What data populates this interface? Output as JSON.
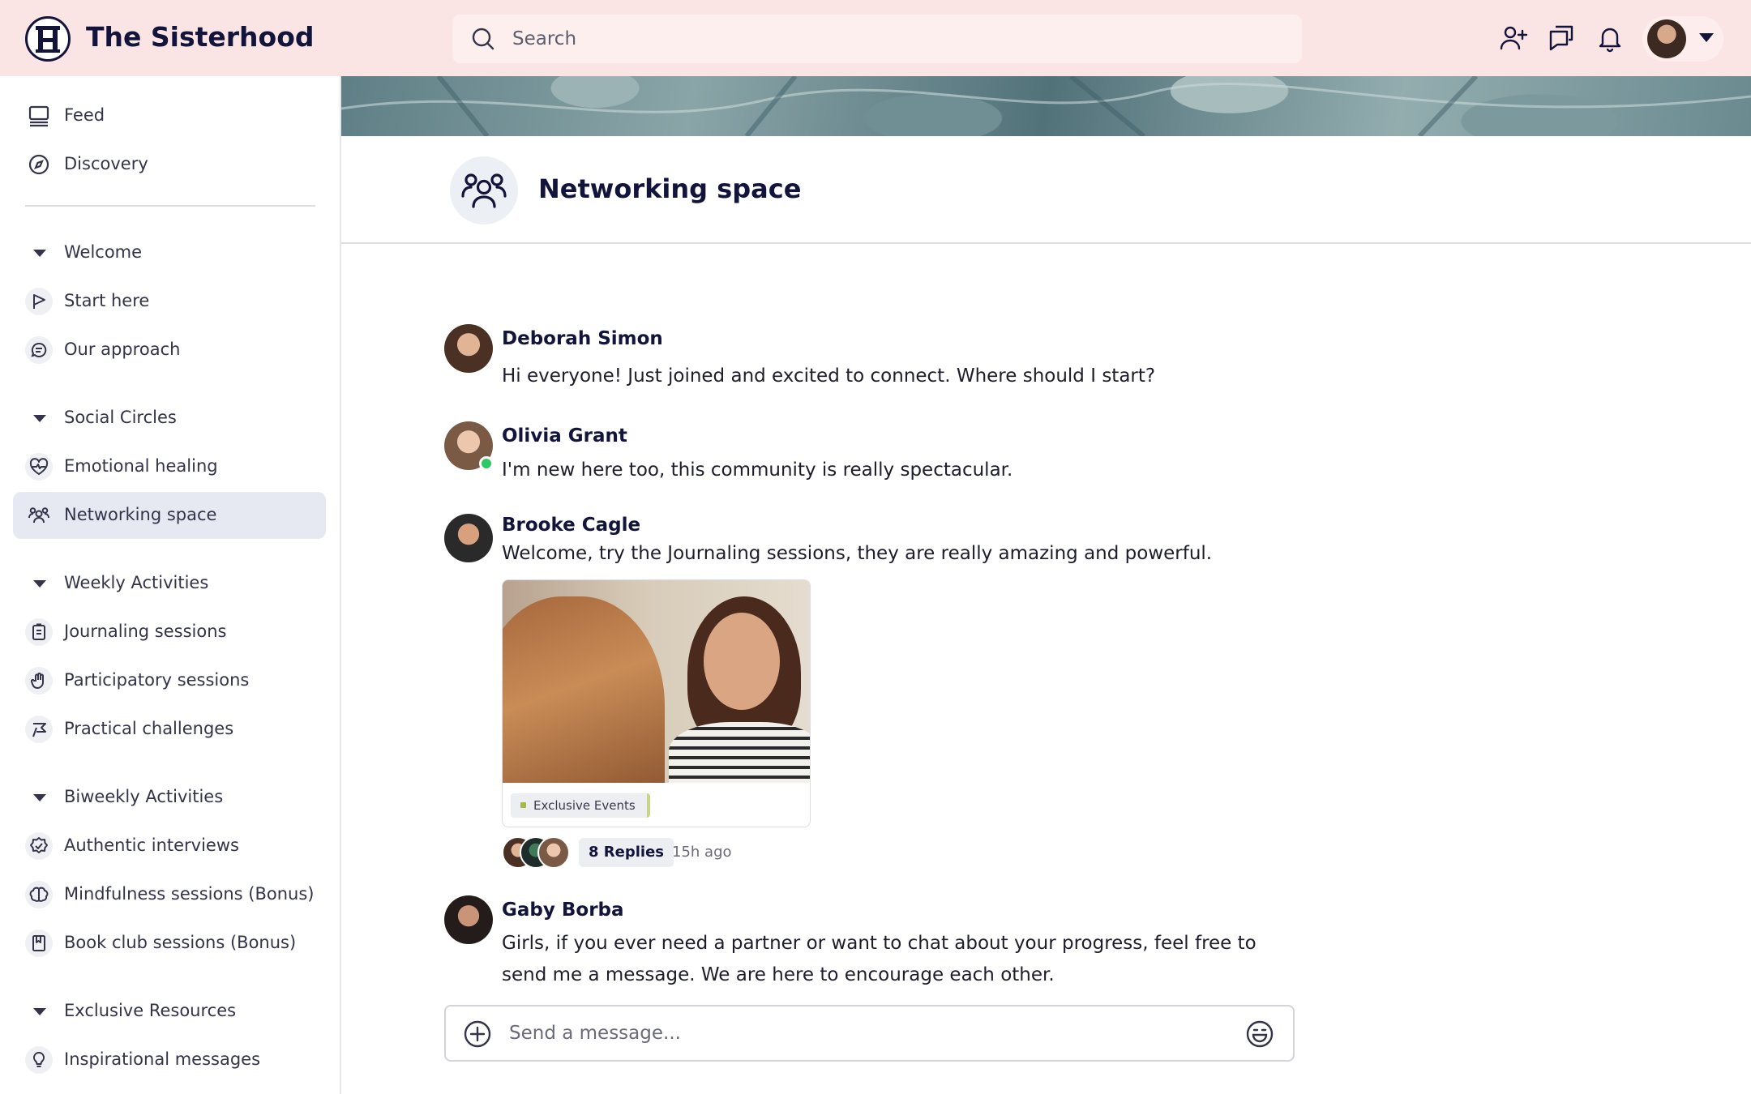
{
  "app": {
    "brand": "The Sisterhood"
  },
  "search": {
    "placeholder": "Search"
  },
  "topbar": {
    "icons": [
      "add-friend-icon",
      "messages-icon",
      "bell-icon"
    ],
    "account_menu_icon": "chevron-down-icon"
  },
  "sidebar": {
    "top": [
      {
        "label": "Feed",
        "icon": "monitor-icon"
      },
      {
        "label": "Discovery",
        "icon": "compass-icon"
      }
    ],
    "sections": [
      {
        "title": "Welcome",
        "items": [
          {
            "label": "Start here",
            "icon": "flag-icon"
          },
          {
            "label": "Our approach",
            "icon": "chat-icon"
          }
        ]
      },
      {
        "title": "Social Circles",
        "items": [
          {
            "label": "Emotional healing",
            "icon": "heart-pulse-icon"
          },
          {
            "label": "Networking space",
            "icon": "users-icon",
            "active": true
          }
        ]
      },
      {
        "title": "Weekly Activities",
        "items": [
          {
            "label": "Journaling sessions",
            "icon": "clipboard-icon"
          },
          {
            "label": "Participatory sessions",
            "icon": "hand-icon"
          },
          {
            "label": "Practical challenges",
            "icon": "flag-zigzag-icon"
          }
        ]
      },
      {
        "title": "Biweekly Activities",
        "items": [
          {
            "label": "Authentic interviews",
            "icon": "badge-check-icon"
          },
          {
            "label": "Mindfulness sessions (Bonus)",
            "icon": "brain-icon"
          },
          {
            "label": "Book club sessions (Bonus)",
            "icon": "book-icon"
          }
        ]
      },
      {
        "title": "Exclusive Resources",
        "items": [
          {
            "label": "Inspirational messages",
            "icon": "lightbulb-icon"
          }
        ]
      }
    ]
  },
  "space": {
    "title": "Networking space",
    "icon": "users-icon"
  },
  "messages": [
    {
      "author": "Deborah Simon",
      "text": "Hi everyone! Just joined and excited to connect. Where should I start?"
    },
    {
      "author": "Olivia Grant",
      "text": "I'm new here too, this community is really spectacular.",
      "online": true
    },
    {
      "author": "Brooke Cagle",
      "text": "Welcome, try the Journaling sessions, they are really amazing and powerful.",
      "attachment": {
        "tag": "Exclusive Events"
      },
      "replies": "8 Replies",
      "time": "15h ago"
    },
    {
      "author": "Gaby Borba",
      "text": "Girls, if you ever need a partner or want to chat about your progress, feel free to send me a message. We are here to encourage each other."
    }
  ],
  "composer": {
    "placeholder": "Send a message..."
  },
  "colors": {
    "topbar": "#fbe5e4",
    "navy": "#13143b",
    "active_item": "#e6e9f1",
    "online": "#2ec866"
  }
}
